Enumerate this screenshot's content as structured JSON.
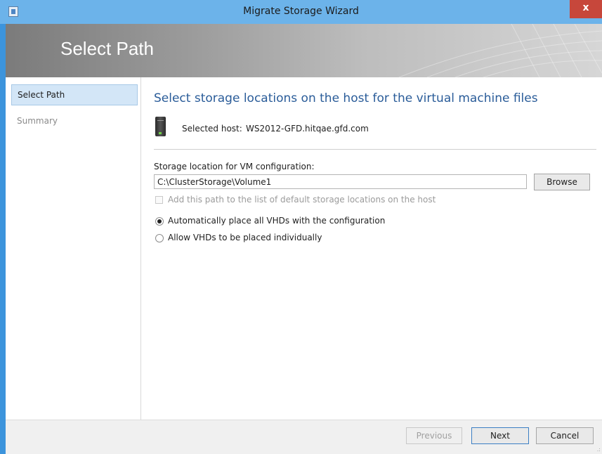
{
  "window": {
    "title": "Migrate Storage Wizard",
    "close_glyph": "x",
    "icon": "wizard-window-icon",
    "accent_color": "#3c94dc"
  },
  "banner": {
    "title": "Select Path"
  },
  "sidebar": {
    "items": [
      {
        "label": "Select Path",
        "active": true
      },
      {
        "label": "Summary",
        "active": false
      }
    ]
  },
  "main": {
    "heading": "Select storage locations on the host for the virtual machine files",
    "host_icon": "server-icon",
    "host_label": "Selected host:",
    "host_value": "WS2012-GFD.hitqae.gfd.com",
    "storage_label": "Storage location for VM configuration:",
    "storage_path": "C:\\ClusterStorage\\Volume1",
    "browse_label": "Browse",
    "add_default_label": "Add this path to the list of default storage locations on the host",
    "add_default_checked": false,
    "add_default_enabled": false,
    "radio_options": [
      {
        "label": "Automatically place all VHDs with the configuration",
        "selected": true
      },
      {
        "label": "Allow VHDs to be placed individually",
        "selected": false
      }
    ]
  },
  "footer": {
    "previous_label": "Previous",
    "previous_enabled": false,
    "next_label": "Next",
    "cancel_label": "Cancel"
  }
}
